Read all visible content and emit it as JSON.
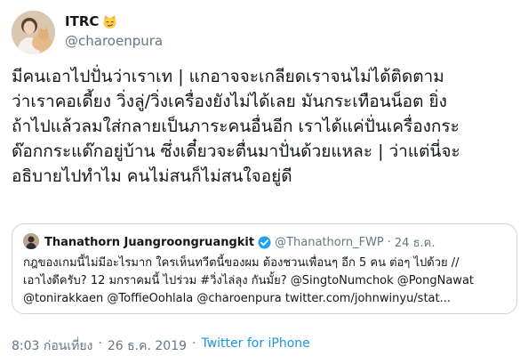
{
  "author": {
    "display_name": "ITRC",
    "badge_icon": "smirking-cat-emoji-icon",
    "handle": "@charoenpura"
  },
  "tweet": {
    "text": "มีคนเอาไปปั่นว่าเราเท | แกอาจจะเกลียดเราจนไม่ได้ติดตาม\nว่าเราคอเดี้ยง วิ่งลู่/วิ่งเครื่องยังไม่ได้เลย มันกระเทือนน็อต ยิ่ง\nถ้าไปแล้วลมใส่กลายเป็นภาระคนอื่นอีก เราได้แค่ปั่นเครื่องกระ\nด๊อกกระแด๊กอยู่บ้าน ซึ่งเดี๋ยวจะตื่นมาปั่นด้วยแหละ | ว่าแต่นี่จะ\nอธิบายไปทำไม คนไม่สนก็ไม่สนใจอยู่ดี"
  },
  "quoted": {
    "name": "Thanathorn Juangroongruangkit",
    "verified_icon": "verified-badge-icon",
    "handle": "@Thanathorn_FWP",
    "separator": "·",
    "date": "24 ธ.ค.",
    "text": "กฎของเกมนี้ไม่มีอะไรมาก ใครเห็นทวีตนี้ของผม ต้องชวนเพื่อนๆ อีก 5 คน ต่อๆ ไปด้วย  //\nเอาไงดีครับ? 12 มกราคมนี้ ไปร่วม #วิ่งไล่ลุง กันมั้ย? @SingtoNumchok @PongNawat\n@tonirakkaen @ToffieOohlala @charoenpura twitter.com/johnwinyu/stat..."
  },
  "footer": {
    "time": "8:03 ก่อนเที่ยง",
    "separator1": "·",
    "date": "26 ธ.ค. 2019",
    "separator2": "·",
    "source": "Twitter for iPhone"
  },
  "colors": {
    "link": "#1b95e0",
    "muted": "#657786",
    "verified": "#1da1f2"
  }
}
